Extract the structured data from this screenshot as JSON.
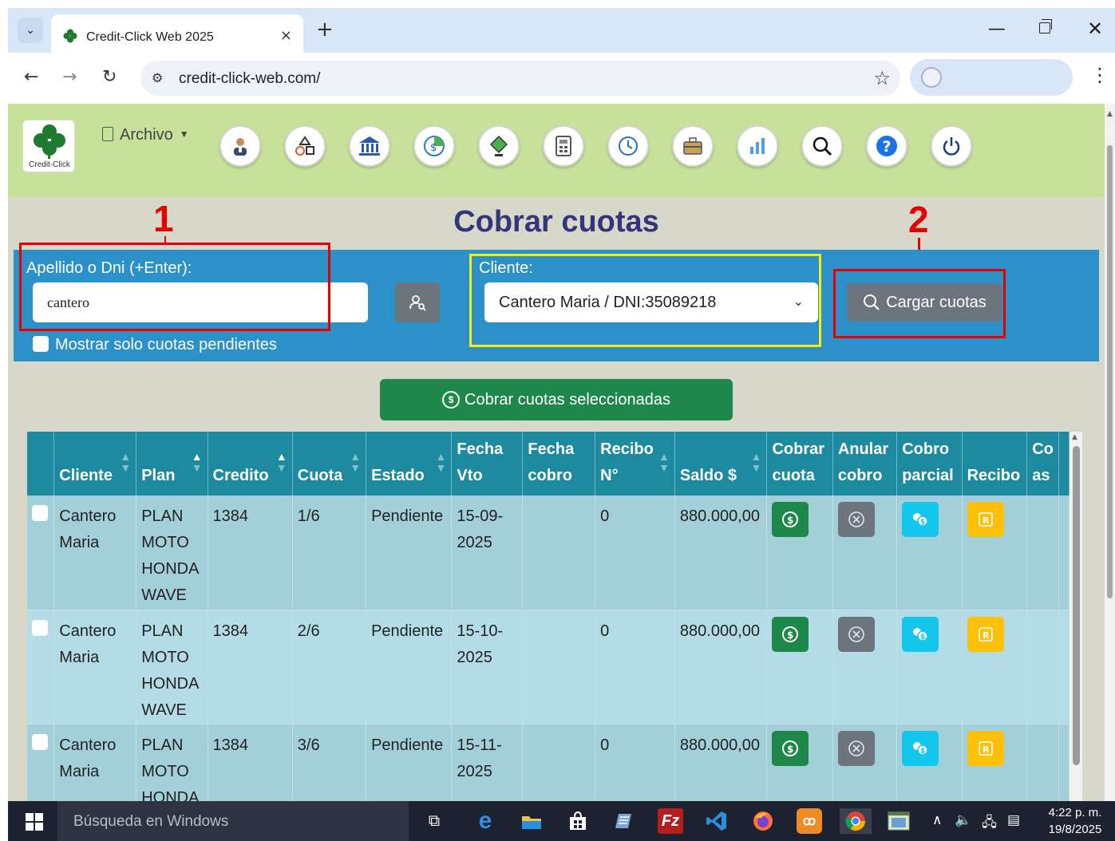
{
  "browser": {
    "tab_title": "Credit-Click Web 2025",
    "tab_close": "×",
    "new_tab": "+",
    "url": "credit-click-web.com/"
  },
  "app": {
    "logo_text": "Credit-Click",
    "archivo_label": "Archivo",
    "toolbar_icons": [
      "clientes-icon",
      "planes-icon",
      "banco-icon",
      "cobros-icon",
      "pagos-icon",
      "calculadora-icon",
      "reloj-icon",
      "caja-icon",
      "graficos-icon",
      "buscar-icon",
      "ayuda-icon",
      "salir-icon"
    ]
  },
  "page": {
    "title": "Cobrar cuotas",
    "mark_1": "1",
    "mark_2": "2"
  },
  "search": {
    "label": "Apellido o Dni (+Enter):",
    "value": "cantero",
    "checkbox_label": "Mostrar solo cuotas pendientes"
  },
  "client": {
    "label": "Cliente:",
    "selected": "Cantero Maria / DNI:35089218"
  },
  "buttons": {
    "cargar": "Cargar cuotas",
    "cobrar_seleccionadas": "Cobrar cuotas seleccionadas"
  },
  "table": {
    "headers": [
      {
        "l1": "",
        "l2": "Cliente"
      },
      {
        "l1": "",
        "l2": "Plan"
      },
      {
        "l1": "",
        "l2": "Credito"
      },
      {
        "l1": "",
        "l2": "Cuota"
      },
      {
        "l1": "",
        "l2": "Estado"
      },
      {
        "l1": "Fecha",
        "l2": "Vto"
      },
      {
        "l1": "Fecha",
        "l2": "cobro"
      },
      {
        "l1": "Recibo",
        "l2": "N°"
      },
      {
        "l1": "",
        "l2": "Saldo $"
      },
      {
        "l1": "Cobrar",
        "l2": "cuota"
      },
      {
        "l1": "Anular",
        "l2": "cobro"
      },
      {
        "l1": "Cobro",
        "l2": "parcial"
      },
      {
        "l1": "",
        "l2": "Recibo"
      },
      {
        "l1": "Co",
        "l2": "as"
      }
    ],
    "rows": [
      {
        "cliente": "Cantero Maria",
        "plan": "PLAN MOTO HONDA WAVE",
        "credito": "1384",
        "cuota": "1/6",
        "estado": "Pendiente",
        "fecha_vto": "15-09-2025",
        "fecha_cobro": "",
        "recibo": "0",
        "saldo": "880.000,00"
      },
      {
        "cliente": "Cantero Maria",
        "plan": "PLAN MOTO HONDA WAVE",
        "credito": "1384",
        "cuota": "2/6",
        "estado": "Pendiente",
        "fecha_vto": "15-10-2025",
        "fecha_cobro": "",
        "recibo": "0",
        "saldo": "880.000,00"
      },
      {
        "cliente": "Cantero Maria",
        "plan": "PLAN MOTO HONDA",
        "credito": "1384",
        "cuota": "3/6",
        "estado": "Pendiente",
        "fecha_vto": "15-11-2025",
        "fecha_cobro": "",
        "recibo": "0",
        "saldo": "880.000,00"
      }
    ]
  },
  "taskbar": {
    "search_placeholder": "Búsqueda en Windows",
    "time": "4:22 p. m.",
    "date": "19/8/2025"
  },
  "colors": {
    "appbar": "#c8e19a",
    "panel": "#2b91c8",
    "title": "#33367a",
    "header": "#1d8aa0",
    "cobrar_green": "#1e874a",
    "annotation_red": "#e60000",
    "annotation_yellow": "#f3ef10"
  }
}
